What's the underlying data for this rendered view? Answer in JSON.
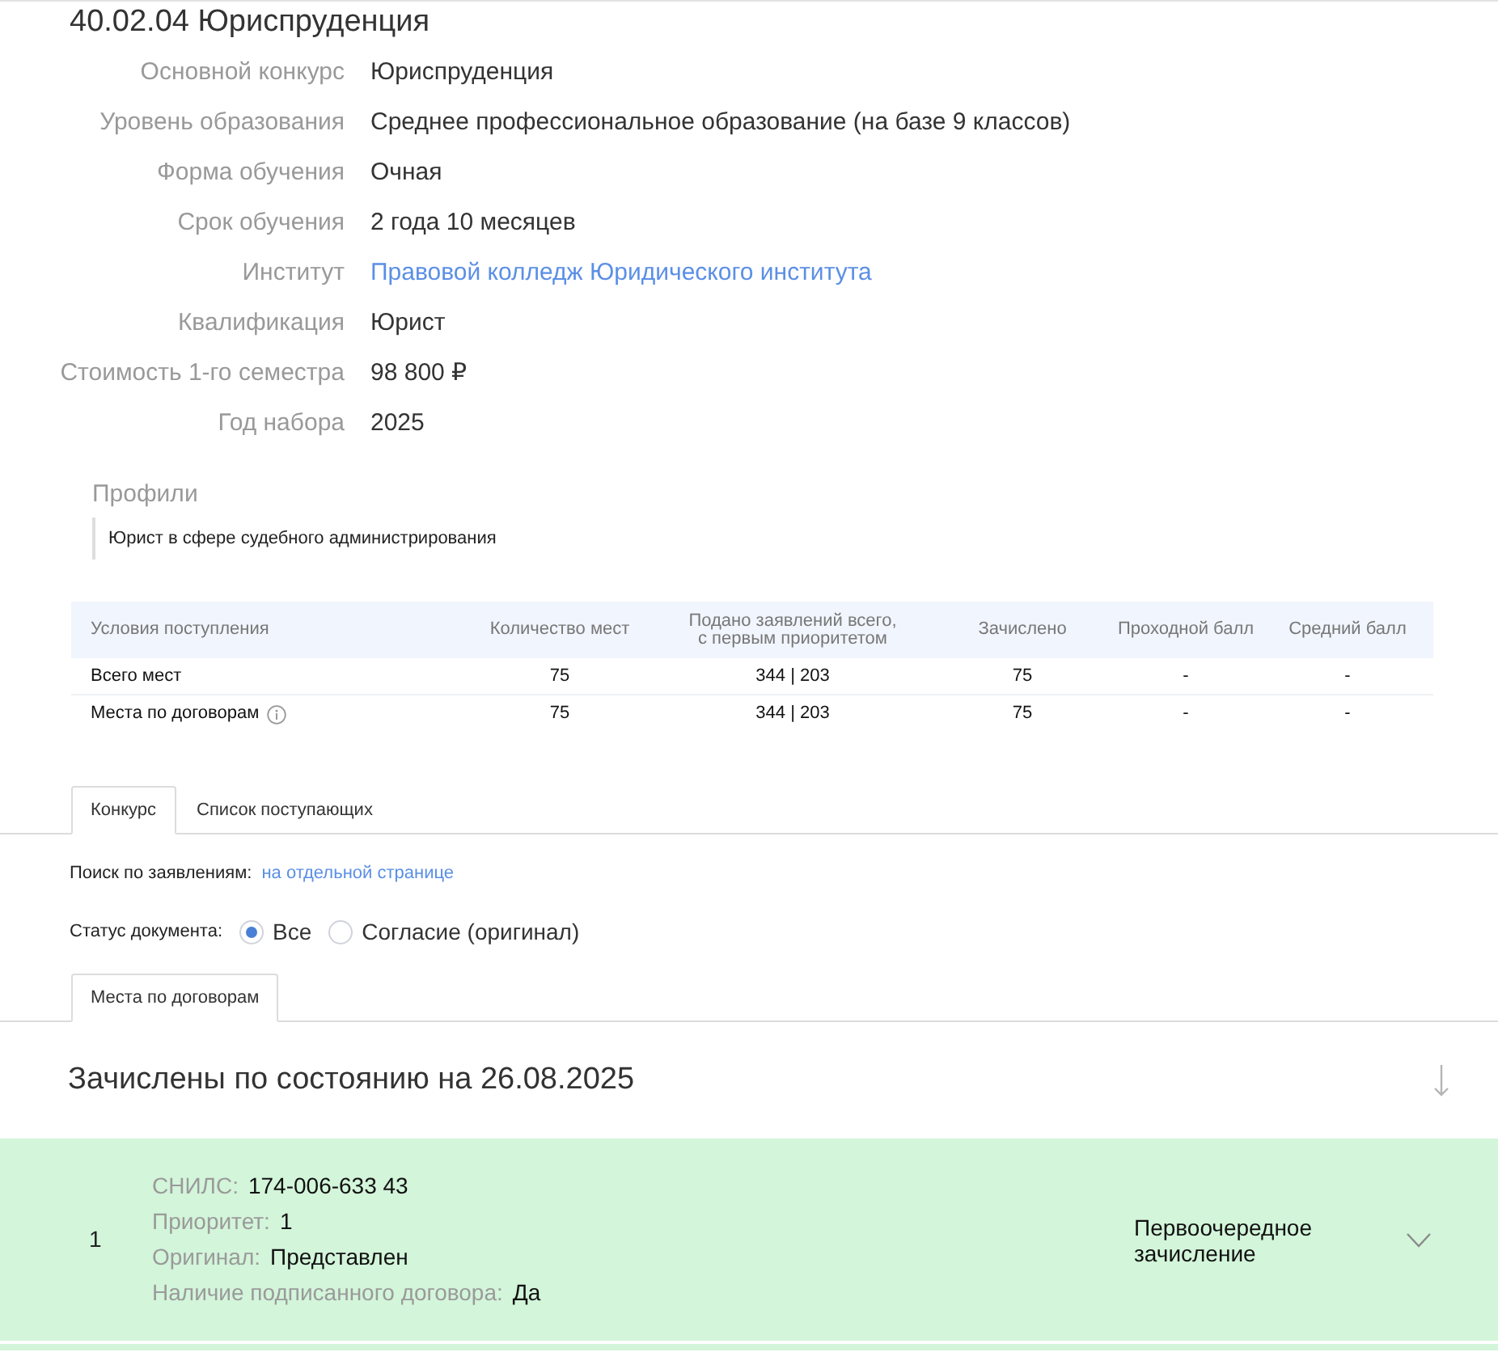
{
  "title": "40.02.04 Юриспруденция",
  "details": [
    {
      "label": "Основной конкурс",
      "value": "Юриспруденция",
      "kind": "text"
    },
    {
      "label": "Уровень образования",
      "value": "Среднее профессиональное образование (на базе 9 классов)",
      "kind": "text"
    },
    {
      "label": "Форма обучения",
      "value": "Очная",
      "kind": "text"
    },
    {
      "label": "Срок обучения",
      "value": "2 года 10 месяцев",
      "kind": "text"
    },
    {
      "label": "Институт",
      "value": "Правовой колледж Юридического института",
      "kind": "link"
    },
    {
      "label": "Квалификация",
      "value": "Юрист",
      "kind": "text"
    },
    {
      "label": "Стоимость 1-го семестра",
      "value": "98 800 ₽",
      "kind": "text"
    },
    {
      "label": "Год набора",
      "value": "2025",
      "kind": "text"
    }
  ],
  "profiles": {
    "heading": "Профили",
    "items": [
      "Юрист в сфере судебного администрирования"
    ]
  },
  "admission_table": {
    "columns": [
      "Условия поступления",
      "Количество мест",
      "Подано заявлений всего,\nс первым приоритетом",
      "Зачислено",
      "Проходной балл",
      "Средний балл"
    ],
    "rows": [
      {
        "cells": [
          "Всего мест",
          "75",
          "344 | 203",
          "75",
          "-",
          "-"
        ],
        "info": false
      },
      {
        "cells": [
          "Места по договорам",
          "75",
          "344 | 203",
          "75",
          "-",
          "-"
        ],
        "info": true
      }
    ]
  },
  "tabs": [
    {
      "label": "Конкурс",
      "selected": true
    },
    {
      "label": "Список поступающих",
      "selected": false
    }
  ],
  "search": {
    "label": "Поиск по заявлениям:",
    "link": "на отдельной странице"
  },
  "document_status": {
    "label": "Статус документа:",
    "options": [
      {
        "label": "Все",
        "selected": true
      },
      {
        "label": "Согласие (оригинал)",
        "selected": false
      }
    ]
  },
  "places_tabs": [
    {
      "label": "Места по договорам",
      "selected": true
    }
  ],
  "enrolled": {
    "heading": "Зачислены по состоянию на 26.08.2025",
    "applicants": [
      {
        "number": "1",
        "fields": [
          {
            "label": "СНИЛС:",
            "value": "174-006-633 43"
          },
          {
            "label": "Приоритет:",
            "value": "1"
          },
          {
            "label": "Оригинал:",
            "value": "Представлен"
          },
          {
            "label": "Наличие подписанного договора:",
            "value": "Да"
          }
        ],
        "status": "Первоочередное зачисление",
        "expanded": false
      }
    ]
  }
}
